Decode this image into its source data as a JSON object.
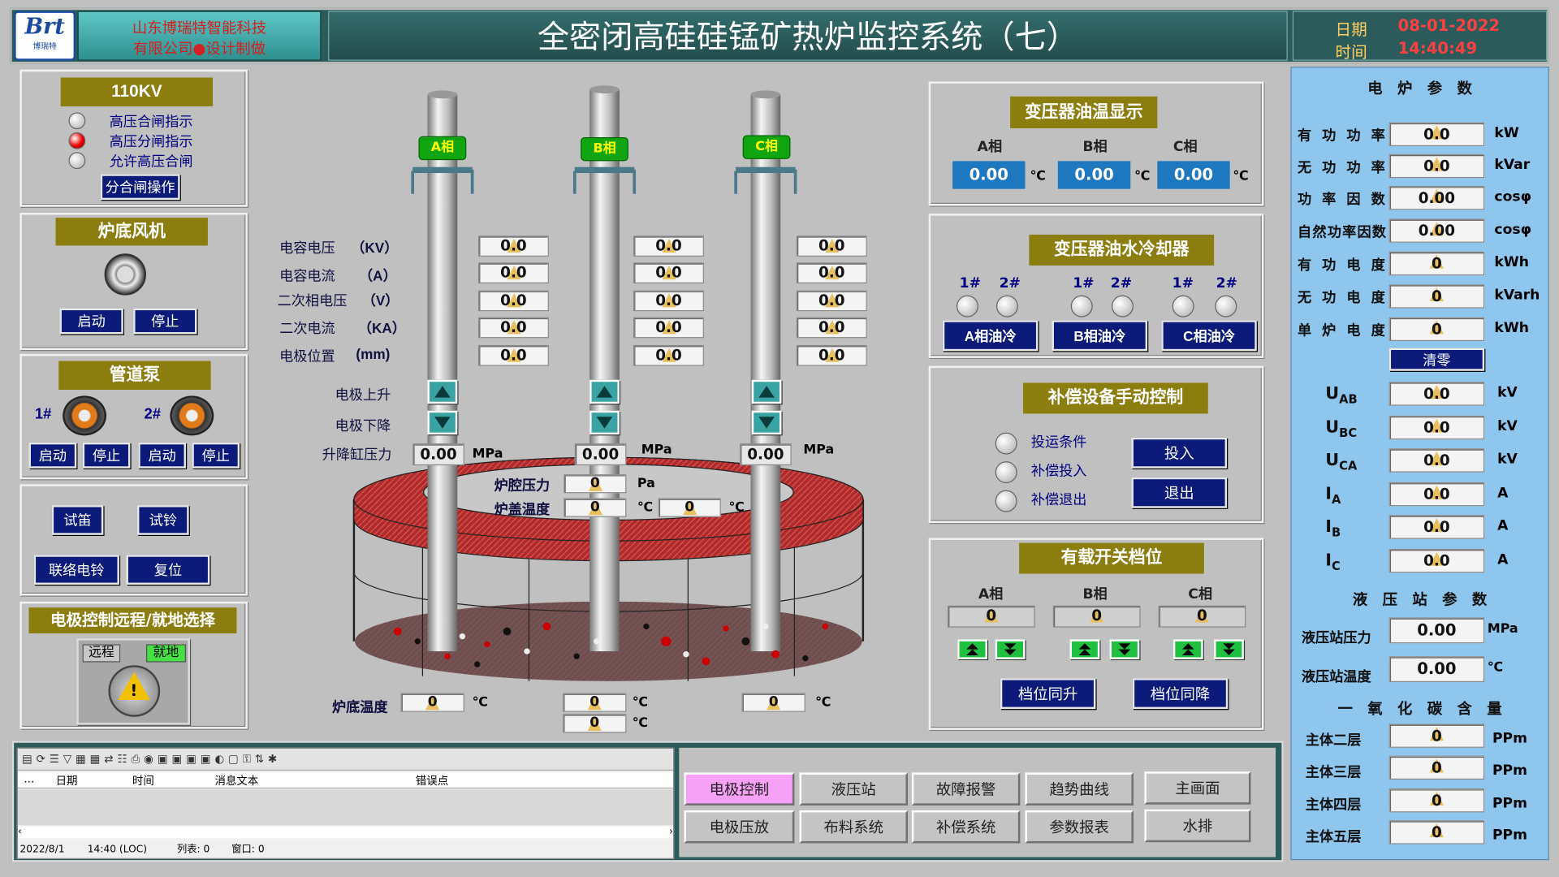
{
  "header": {
    "company_line1": "山东博瑞特智能科技",
    "company_line2": "有限公司●设计制做",
    "logo_text": "Brt",
    "logo_sub": "博瑞特",
    "title": "全密闭高硅硅锰矿热炉监控系统（七）",
    "date_label": "日期",
    "date_value": "08-01-2022",
    "time_label": "时间",
    "time_value": "14:40:49"
  },
  "left": {
    "kv": {
      "title": "110KV",
      "items": [
        "高压合闸指示",
        "高压分闸指示",
        "允许高压合闸"
      ],
      "button": "分合闸操作"
    },
    "fan": {
      "title": "炉底风机",
      "start": "启动",
      "stop": "停止"
    },
    "pump": {
      "title": "管道泵",
      "p1": "1#",
      "p2": "2#",
      "start": "启动",
      "stop": "停止"
    },
    "misc": {
      "b1": "试笛",
      "b2": "试铃",
      "b3": "联络电铃",
      "b4": "复位"
    },
    "remote": {
      "title": "电极控制远程/就地选择",
      "remote": "远程",
      "local": "就地"
    }
  },
  "center": {
    "phases": [
      "A相",
      "B相",
      "C相"
    ],
    "labels": {
      "cap_v": "电容电压",
      "cap_v_u": "（KV）",
      "cap_i": "电容电流",
      "cap_i_u": "（A）",
      "sec_v": "二次相电压",
      "sec_v_u": "（V）",
      "sec_i": "二次电流",
      "sec_i_u": "（KA）",
      "pos": "电极位置",
      "pos_u": "(mm)",
      "up": "电极上升",
      "down": "电极下降",
      "cyl": "升降缸压力",
      "mpa": "MPa"
    },
    "values": {
      "a": [
        "0.0",
        "0.0",
        "0.0",
        "0.0",
        "0.0"
      ],
      "b": [
        "0.0",
        "0.0",
        "0.0",
        "0.0",
        "0.0"
      ],
      "c": [
        "0.0",
        "0.0",
        "0.0",
        "0.0",
        "0.0"
      ]
    },
    "cyl_values": [
      "0.00",
      "0.00",
      "0.00"
    ],
    "furnace": {
      "cavity_label": "炉腔压力",
      "cavity_value": "0",
      "cavity_unit": "Pa",
      "lid_label": "炉盖温度",
      "lid_v1": "0",
      "lid_v2": "0",
      "deg": "℃",
      "bottom_label": "炉底温度",
      "b1": "0",
      "b2": "0",
      "b3": "0",
      "b4": "0"
    }
  },
  "mid": {
    "oil_temp": {
      "title": "变压器油温显示",
      "a": "A相",
      "b": "B相",
      "c": "C相",
      "va": "0.00",
      "vb": "0.00",
      "vc": "0.00",
      "unit": "℃"
    },
    "cooler": {
      "title": "变压器油水冷却器",
      "n1": "1#",
      "n2": "2#",
      "a": "A相油冷",
      "b": "B相油冷",
      "c": "C相油冷"
    },
    "comp": {
      "title": "补偿设备手动控制",
      "c1": "投运条件",
      "c2": "补偿投入",
      "c3": "补偿退出",
      "on": "投入",
      "off": "退出"
    },
    "tap": {
      "title": "有载开关档位",
      "a": "A相",
      "b": "B相",
      "c": "C相",
      "va": "0",
      "vb": "0",
      "vc": "0",
      "up": "档位同升",
      "down": "档位同降"
    }
  },
  "right": {
    "title": "电　炉　参　数",
    "rows": [
      {
        "label": "有功功率",
        "value": "0.0",
        "unit": "kW"
      },
      {
        "label": "无功功率",
        "value": "0.0",
        "unit": "kVar"
      },
      {
        "label": "功率因数",
        "value": "0.00",
        "unit": "cosφ"
      },
      {
        "label": "自然功率因数",
        "value": "0.00",
        "unit": "cosφ"
      },
      {
        "label": "有功电度",
        "value": "0",
        "unit": "kWh"
      },
      {
        "label": "无功电度",
        "value": "0",
        "unit": "kVarh"
      },
      {
        "label": "单炉电度",
        "value": "0",
        "unit": "kWh"
      }
    ],
    "clear": "清零",
    "elec": [
      {
        "label": "U",
        "sub": "AB",
        "value": "0.0",
        "unit": "kV"
      },
      {
        "label": "U",
        "sub": "BC",
        "value": "0.0",
        "unit": "kV"
      },
      {
        "label": "U",
        "sub": "CA",
        "value": "0.0",
        "unit": "kV"
      },
      {
        "label": "I",
        "sub": "A",
        "value": "0.0",
        "unit": "A"
      },
      {
        "label": "I",
        "sub": "B",
        "value": "0.0",
        "unit": "A"
      },
      {
        "label": "I",
        "sub": "C",
        "value": "0.0",
        "unit": "A"
      }
    ],
    "hyd_title": "液　压　站　参　数",
    "hyd": [
      {
        "label": "液压站压力",
        "value": "0.00",
        "unit": "MPa"
      },
      {
        "label": "液压站温度",
        "value": "0.00",
        "unit": "℃"
      }
    ],
    "co_title": "一　氧　化　碳　含　量",
    "co": [
      {
        "label": "主体二层",
        "value": "0",
        "unit": "PPm"
      },
      {
        "label": "主体三层",
        "value": "0",
        "unit": "PPm"
      },
      {
        "label": "主体四层",
        "value": "0",
        "unit": "PPm"
      },
      {
        "label": "主体五层",
        "value": "0",
        "unit": "PPm"
      }
    ]
  },
  "alarm": {
    "cols": [
      "...",
      "日期",
      "时间",
      "消息文本",
      "错误点"
    ],
    "status_date": "2022/8/1",
    "status_time": "14:40 (LOC)",
    "status_rows": "列表:   0",
    "status_win": "窗口:   0"
  },
  "nav": [
    "电极控制",
    "液压站",
    "故障报警",
    "趋势曲线",
    "主画面",
    "电极压放",
    "布料系统",
    "补偿系统",
    "参数报表",
    "水排"
  ],
  "colors": {
    "accent_active": "#f6a0f6",
    "header_bg": "#2c5b5b",
    "value_blue": "#1e78c0",
    "olive": "#8b7d0e",
    "navy": "#0c1a7a"
  }
}
